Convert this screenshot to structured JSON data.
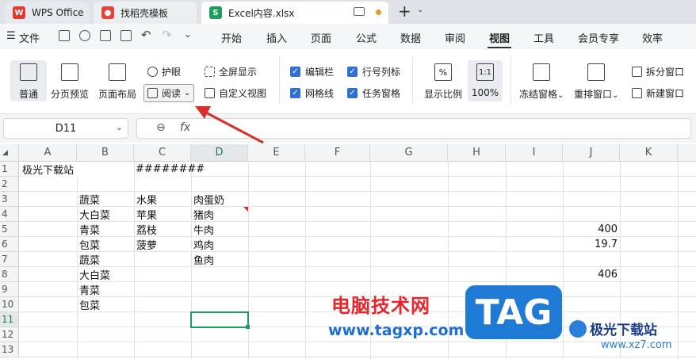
{
  "tabs": [
    {
      "label": "WPS Office",
      "icon": "wps-logo-icon"
    },
    {
      "label": "找稻壳模板",
      "icon": "docer-icon"
    },
    {
      "label": "Excel内容.xlsx",
      "icon": "sheet-icon",
      "badge": "S"
    }
  ],
  "new_tab": "+",
  "menu": {
    "file": "文件",
    "items": [
      "开始",
      "插入",
      "页面",
      "公式",
      "数据",
      "审阅",
      "视图",
      "工具",
      "会员专享",
      "效率"
    ],
    "active": "视图"
  },
  "ribbon": {
    "normal": "普通",
    "page_break": "分页预览",
    "page_layout": "页面布局",
    "eye_care": "护眼",
    "reading": "阅读",
    "fullscreen": "全屏显示",
    "custom_view": "自定义视图",
    "checks": {
      "edit_bar": "编辑栏",
      "row_col_headers": "行号列标",
      "gridlines": "网格线",
      "task_pane": "任务窗格"
    },
    "zoom": "显示比例",
    "zoom_100_label": "100%",
    "zoom_100_icon": "1:1",
    "freeze": "冻结窗格",
    "rearrange": "重排窗口",
    "split": "拆分窗口",
    "new_window": "新建窗口"
  },
  "formula_bar": {
    "name_box": "D11",
    "fx": "fx"
  },
  "columns": [
    "A",
    "B",
    "C",
    "D",
    "E",
    "F",
    "G",
    "H",
    "I",
    "J",
    "K"
  ],
  "rows": [
    "1",
    "2",
    "3",
    "4",
    "5",
    "6",
    "7",
    "8",
    "9",
    "10",
    "11",
    "12",
    "13"
  ],
  "cells": {
    "A1": "极光下载站",
    "C1": "########",
    "B3": "蔬菜",
    "C3": "水果",
    "D3": "肉蛋奶",
    "B4": "大白菜",
    "C4": "苹果",
    "D4": "猪肉",
    "B5": "青菜",
    "C5": "荔枝",
    "D5": "牛肉",
    "J5": "400",
    "B6": "包菜",
    "C6": "菠萝",
    "D6": "鸡肉",
    "J6": "19.7",
    "B7": "蔬菜",
    "D7": "鱼肉",
    "B8": "大白菜",
    "J8": "406",
    "B9": "青菜",
    "B10": "包菜"
  },
  "watermark": {
    "cn": "电脑技术网",
    "url": "www.tagxp.com",
    "tag": "TAG",
    "site": "极光下载站",
    "site_url": "www.xz7.com"
  },
  "colors": {
    "accent_red": "#d8302a",
    "check_blue": "#2f6fd6",
    "selection_green": "#1e9e5a"
  }
}
